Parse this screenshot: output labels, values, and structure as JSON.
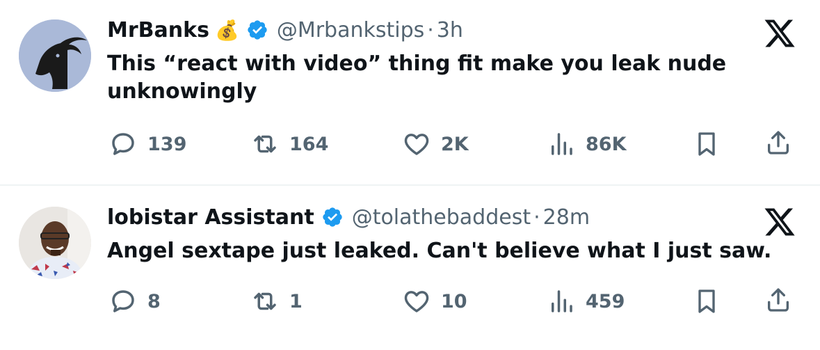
{
  "tweets": [
    {
      "author_name": "MrBanks",
      "author_emoji": "💰",
      "handle": "@Mrbankstips",
      "separator": "·",
      "time": "3h",
      "text_lines": [
        "This “react with video” thing fit make you leak nude",
        "unknowingly"
      ],
      "replies": "139",
      "reposts": "164",
      "likes": "2K",
      "views": "86K"
    },
    {
      "author_name": "lobistar Assistant",
      "handle": "@tolathebaddest",
      "separator": "·",
      "time": "28m",
      "text_lines": [
        "Angel sextape just leaked. Can't believe what I just saw."
      ],
      "replies": "8",
      "reposts": "1",
      "likes": "10",
      "views": "459"
    }
  ],
  "colors": {
    "verified": "#1d9bf0",
    "secondary_text": "#536471",
    "primary_text": "#0f1419",
    "divider": "#eff3f4"
  },
  "icons": [
    "reply-icon",
    "repost-icon",
    "like-icon",
    "views-icon",
    "bookmark-icon",
    "share-icon",
    "x-logo-icon",
    "verified-icon"
  ]
}
